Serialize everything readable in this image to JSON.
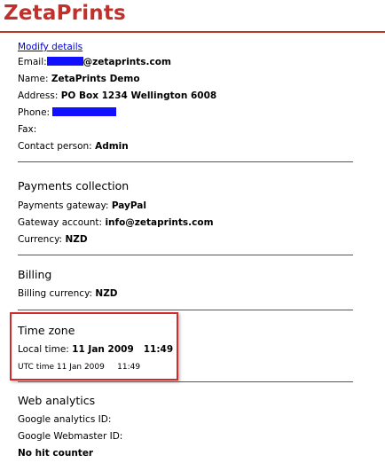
{
  "brand": {
    "name": "ZetaPrints"
  },
  "account": {
    "modify_link": "Modify details",
    "email_label": "Email:",
    "email_suffix": "@zetaprints.com",
    "name_label": "Name:",
    "name_value": "ZetaPrints Demo",
    "address_label": "Address:",
    "address_value": "PO Box 1234 Wellington 6008",
    "phone_label": "Phone:",
    "fax_label": "Fax:",
    "contact_label": "Contact person:",
    "contact_value": "Admin"
  },
  "payments": {
    "title": "Payments collection",
    "gateway_label": "Payments gateway:",
    "gateway_value": "PayPal",
    "account_label": "Gateway account:",
    "account_value": "info@zetaprints.com",
    "currency_label": "Currency:",
    "currency_value": "NZD"
  },
  "billing": {
    "title": "Billing",
    "currency_label": "Billing currency:",
    "currency_value": "NZD"
  },
  "timezone": {
    "title": "Time zone",
    "local_label": "Local time:",
    "local_value": "11 Jan 2009   11:49",
    "utc_text": "UTC time 11 Jan 2009     11:49"
  },
  "analytics": {
    "title": "Web analytics",
    "ga_label": "Google analytics ID:",
    "gwm_label": "Google Webmaster ID:",
    "counter_label": "No hit counter"
  },
  "colors": {
    "brand": "#c0312b",
    "link": "#0000cc",
    "redaction": "#1010ff",
    "highlight": "#d62a2a"
  }
}
